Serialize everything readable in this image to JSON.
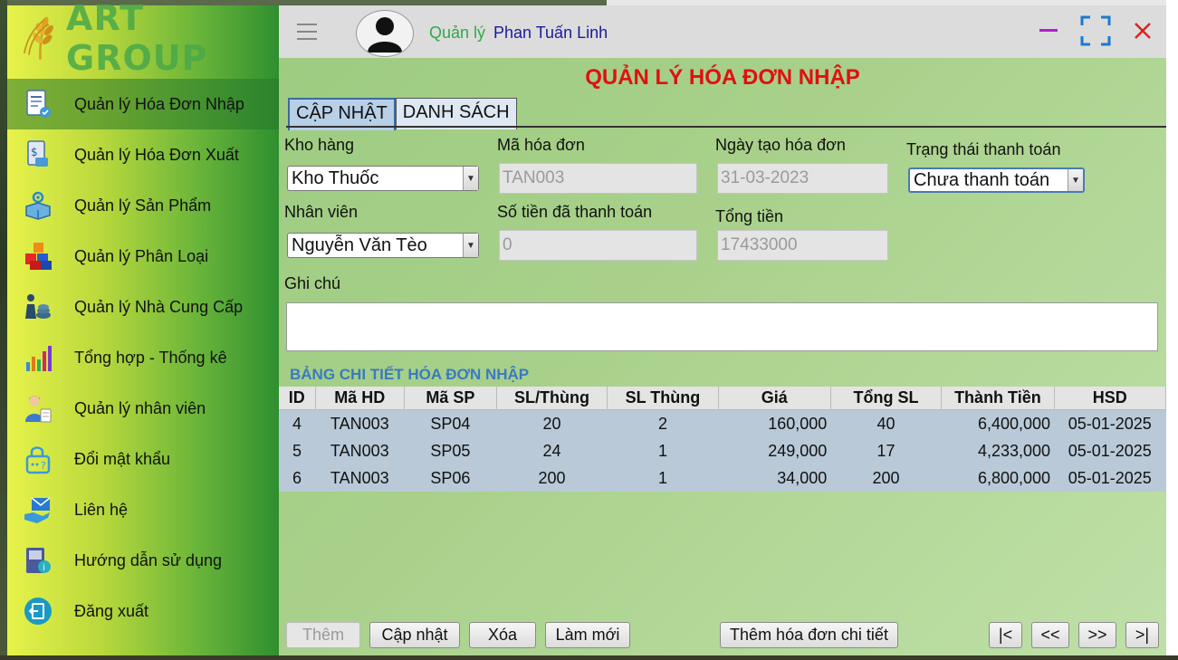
{
  "app": {
    "logo_text": "ART GROUP"
  },
  "header": {
    "role": "Quản lý",
    "user_name": "Phan Tuấn Linh"
  },
  "sidebar": {
    "items": [
      {
        "label": "Quản lý Hóa Đơn Nhập",
        "icon": "invoice-in-icon",
        "active": true
      },
      {
        "label": "Quản lý Hóa Đơn Xuất",
        "icon": "invoice-out-icon"
      },
      {
        "label": "Quản lý Sản Phẩm",
        "icon": "product-gear-icon"
      },
      {
        "label": "Quản lý Phân Loại",
        "icon": "category-blocks-icon"
      },
      {
        "label": "Quản lý Nhà Cung Cấp",
        "icon": "supplier-icon"
      },
      {
        "label": "Tổng hợp - Thống kê",
        "icon": "bar-chart-icon"
      },
      {
        "label": "Quản lý nhân viên",
        "icon": "employee-icon"
      },
      {
        "label": "Đổi mật khẩu",
        "icon": "lock-icon"
      },
      {
        "label": "Liên hệ",
        "icon": "mail-hand-icon"
      },
      {
        "label": "Hướng dẫn sử dụng",
        "icon": "manual-icon"
      },
      {
        "label": "Đăng xuất",
        "icon": "logout-icon"
      }
    ]
  },
  "page": {
    "title": "QUẢN LÝ HÓA ĐƠN NHẬP"
  },
  "tabs": [
    {
      "label": "CẬP NHẬT",
      "active": true
    },
    {
      "label": "DANH SÁCH"
    }
  ],
  "form": {
    "warehouse_label": "Kho hàng",
    "warehouse_value": "Kho Thuốc",
    "invoice_id_label": "Mã hóa đơn",
    "invoice_id_value": "TAN003",
    "created_date_label": "Ngày tạo hóa đơn",
    "created_date_value": "31-03-2023",
    "payment_status_label": "Trạng thái thanh toán",
    "payment_status_value": "Chưa thanh toán",
    "employee_label": "Nhân viên",
    "employee_value": "Nguyễn Văn Tèo",
    "paid_amount_label": "Số tiền đã thanh toán",
    "paid_amount_value": "0",
    "total_label": "Tổng tiền",
    "total_value": "17433000",
    "note_label": "Ghi chú",
    "note_value": ""
  },
  "detail_table": {
    "title": "BẢNG CHI TIẾT HÓA ĐƠN NHẬP",
    "columns": [
      "ID",
      "Mã HD",
      "Mã SP",
      "SL/Thùng",
      "SL Thùng",
      "Giá",
      "Tổng SL",
      "Thành Tiền",
      "HSD"
    ],
    "rows": [
      [
        "4",
        "TAN003",
        "SP04",
        "20",
        "2",
        "160,000",
        "40",
        "6,400,000",
        "05-01-2025"
      ],
      [
        "5",
        "TAN003",
        "SP05",
        "24",
        "1",
        "249,000",
        "17",
        "4,233,000",
        "05-01-2025"
      ],
      [
        "6",
        "TAN003",
        "SP06",
        "200",
        "1",
        "34,000",
        "200",
        "6,800,000",
        "05-01-2025"
      ]
    ]
  },
  "buttons": {
    "add": "Thêm",
    "update": "Cập nhật",
    "delete": "Xóa",
    "refresh": "Làm mới",
    "add_detail": "Thêm hóa đơn chi tiết",
    "first": "|<",
    "prev": "<<",
    "next": ">>",
    "last": ">|"
  }
}
